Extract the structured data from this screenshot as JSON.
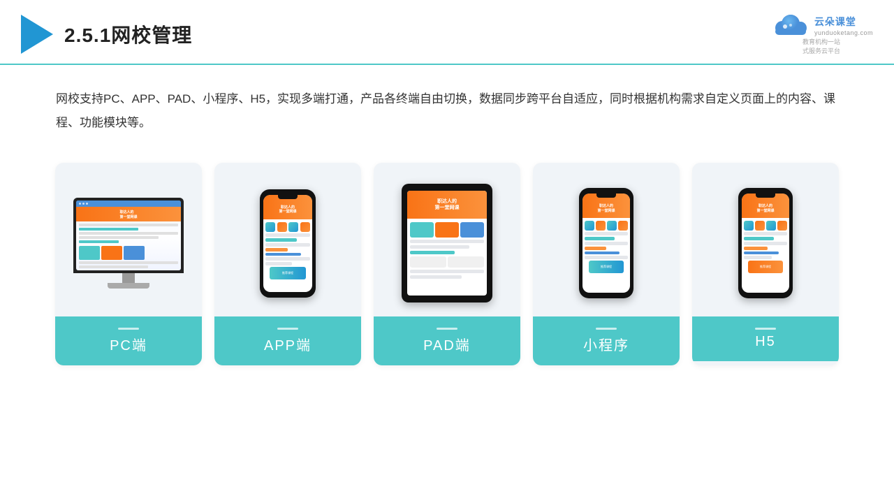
{
  "header": {
    "section_number": "2.5.1",
    "title": "网校管理",
    "brand_name": "云朵课堂",
    "brand_url": "yunduoketang.com",
    "brand_tagline": "教育机构一站\n式服务云平台"
  },
  "description": {
    "text": "网校支持PC、APP、PAD、小程序、H5，实现多端打通，产品各终端自由切换，数据同步跨平台自适应，同时根据机构需求自定义页面上的内容、课程、功能模块等。"
  },
  "cards": [
    {
      "id": "pc",
      "label": "PC端"
    },
    {
      "id": "app",
      "label": "APP端"
    },
    {
      "id": "pad",
      "label": "PAD端"
    },
    {
      "id": "miniprogram",
      "label": "小程序"
    },
    {
      "id": "h5",
      "label": "H5"
    }
  ],
  "colors": {
    "teal": "#4ec8c8",
    "blue": "#2196d3",
    "orange": "#f97316",
    "header_border": "#4ec8c8"
  }
}
